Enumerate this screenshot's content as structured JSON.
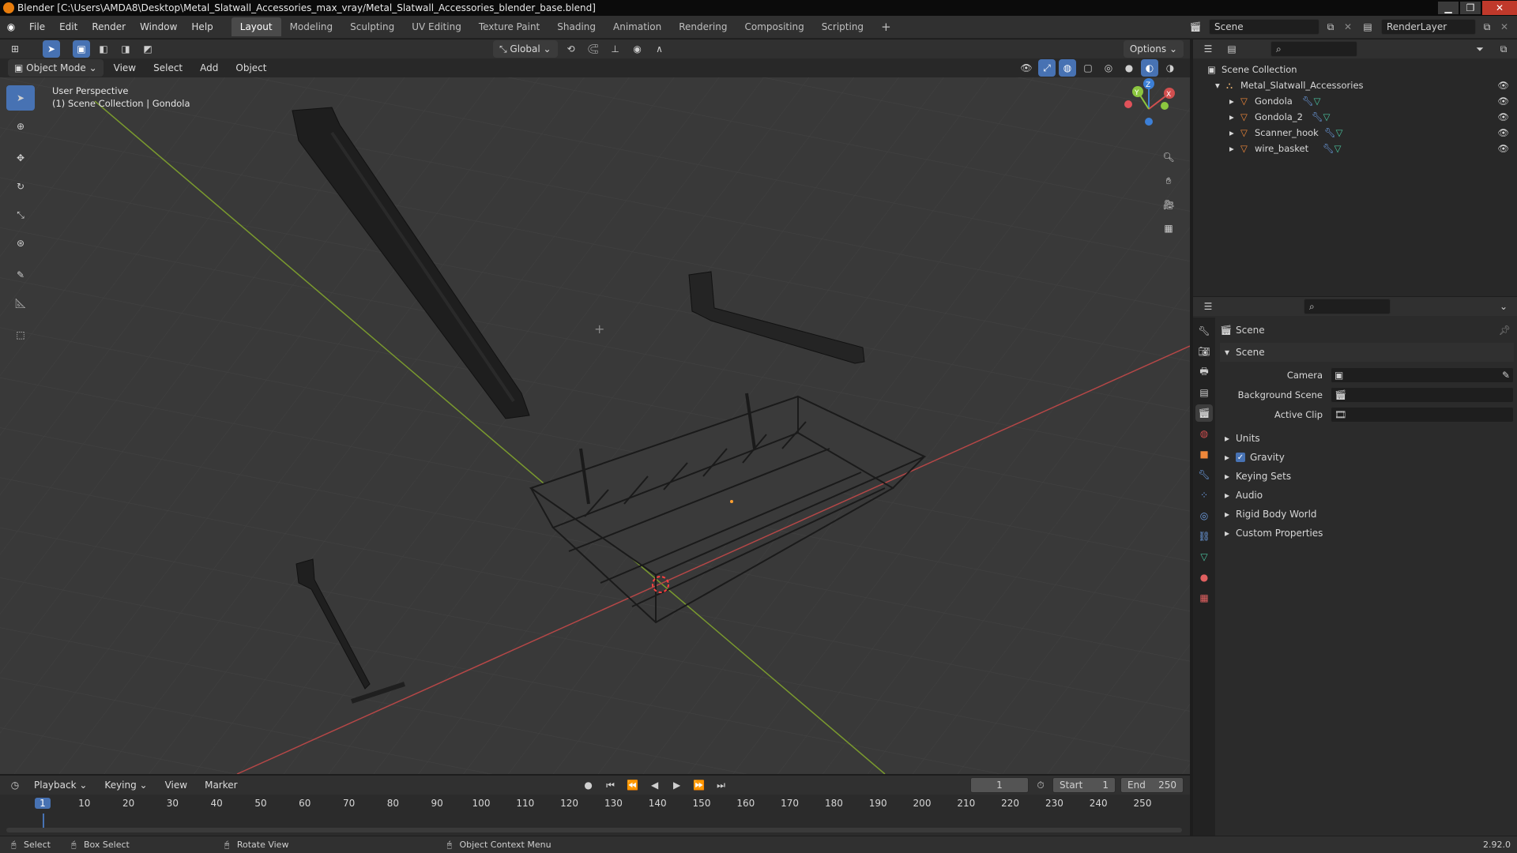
{
  "title_bar": {
    "title": "Blender [C:\\Users\\AMDA8\\Desktop\\Metal_Slatwall_Accessories_max_vray/Metal_Slatwall_Accessories_blender_base.blend]"
  },
  "menu": {
    "items": [
      "File",
      "Edit",
      "Render",
      "Window",
      "Help"
    ]
  },
  "workspaces": {
    "tabs": [
      "Layout",
      "Modeling",
      "Sculpting",
      "UV Editing",
      "Texture Paint",
      "Shading",
      "Animation",
      "Rendering",
      "Compositing",
      "Scripting"
    ],
    "active": "Layout",
    "add": "+"
  },
  "scene_selector": {
    "scene": "Scene",
    "view_layer": "RenderLayer"
  },
  "viewport": {
    "orientation": "Global",
    "options_label": "Options",
    "mode": "Object Mode",
    "header_menu": [
      "View",
      "Select",
      "Add",
      "Object"
    ],
    "info_line1": "User Perspective",
    "info_line2": "(1) Scene Collection | Gondola",
    "gizmo": {
      "x": "X",
      "y": "Y",
      "z": "Z"
    }
  },
  "outliner": {
    "root": "Scene Collection",
    "collection": "Metal_Slatwall_Accessories",
    "objects": [
      "Gondola",
      "Gondola_2",
      "Scanner_hook",
      "wire_basket"
    ]
  },
  "properties": {
    "header_title": "Scene",
    "panel_title": "Scene",
    "fields": [
      {
        "label": "Camera"
      },
      {
        "label": "Background Scene"
      },
      {
        "label": "Active Clip"
      }
    ],
    "subpanels": [
      "Units",
      "Gravity",
      "Keying Sets",
      "Audio",
      "Rigid Body World",
      "Custom Properties"
    ],
    "gravity_checked": true
  },
  "timeline": {
    "menus": [
      "Playback",
      "Keying",
      "View",
      "Marker"
    ],
    "current_frame": "1",
    "start_label": "Start",
    "start": "1",
    "end_label": "End",
    "end": "250",
    "ticks": [
      "1",
      "10",
      "20",
      "30",
      "40",
      "50",
      "60",
      "70",
      "80",
      "90",
      "100",
      "110",
      "120",
      "130",
      "140",
      "150",
      "160",
      "170",
      "180",
      "190",
      "200",
      "210",
      "220",
      "230",
      "240",
      "250"
    ]
  },
  "status_bar": {
    "items": [
      "Select",
      "Box Select",
      "Rotate View",
      "Object Context Menu"
    ],
    "version": "2.92.0"
  },
  "colors": {
    "accent": "#4772b3",
    "x_axis": "#d14f4f",
    "y_axis": "#8cc63f",
    "z_axis": "#3c7fd6"
  }
}
